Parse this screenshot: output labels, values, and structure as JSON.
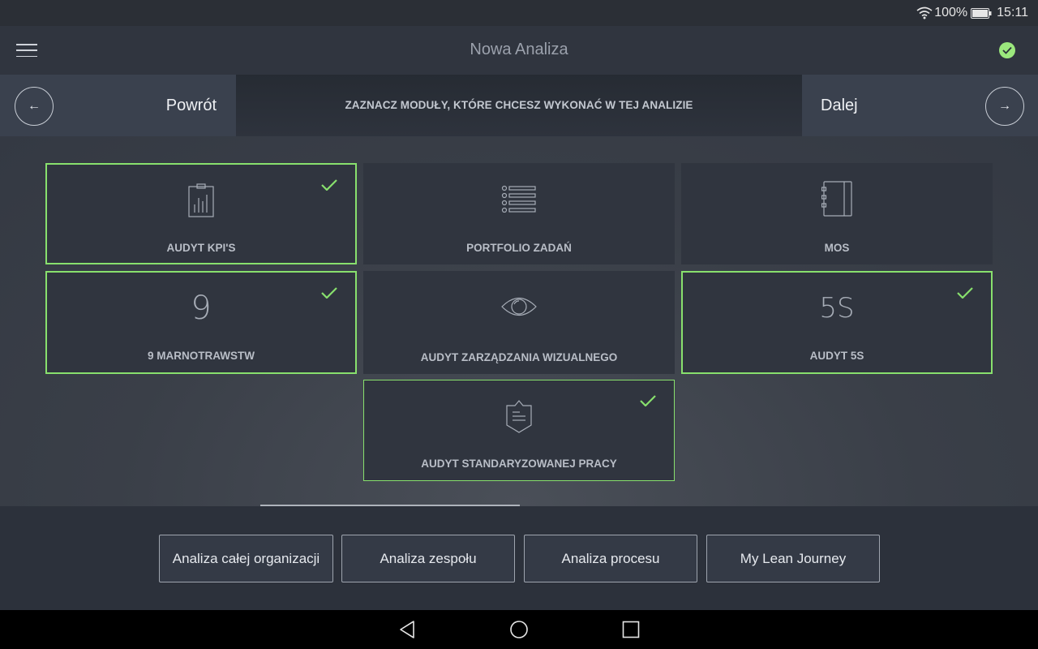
{
  "status_bar": {
    "battery": "100%",
    "time": "15:11"
  },
  "app_bar": {
    "title": "Nowa Analiza"
  },
  "nav": {
    "back_label": "Powrót",
    "back_arrow": "←",
    "next_label": "Dalej",
    "next_arrow": "→",
    "instruction": "ZAZNACZ MODUŁY, KTÓRE CHCESZ WYKONAĆ W TEJ ANALIZIE"
  },
  "modules": [
    {
      "label": "AUDYT KPI'S",
      "icon": "clipboard-chart-icon",
      "selected": true
    },
    {
      "label": "PORTFOLIO ZADAŃ",
      "icon": "list-icon",
      "selected": false
    },
    {
      "label": "MOS",
      "icon": "notebook-icon",
      "selected": false
    },
    {
      "label": "9 MARNOTRAWSTW",
      "icon_text": "9",
      "selected": true
    },
    {
      "label": "AUDYT ZARZĄDZANIA WIZUALNEGO",
      "icon": "eye-icon",
      "selected": false
    },
    {
      "label": "AUDYT 5S",
      "icon_text": "5S",
      "selected": true
    },
    {
      "label": "AUDYT STANDARYZOWANEJ PRACY",
      "icon": "badge-document-icon",
      "selected": true
    }
  ],
  "tabs": [
    {
      "label": "Analiza całej organizacji"
    },
    {
      "label": "Analiza zespołu"
    },
    {
      "label": "Analiza procesu"
    },
    {
      "label": "My Lean Journey"
    }
  ],
  "colors": {
    "accent": "#88e06d",
    "sync": "#9be87d"
  }
}
